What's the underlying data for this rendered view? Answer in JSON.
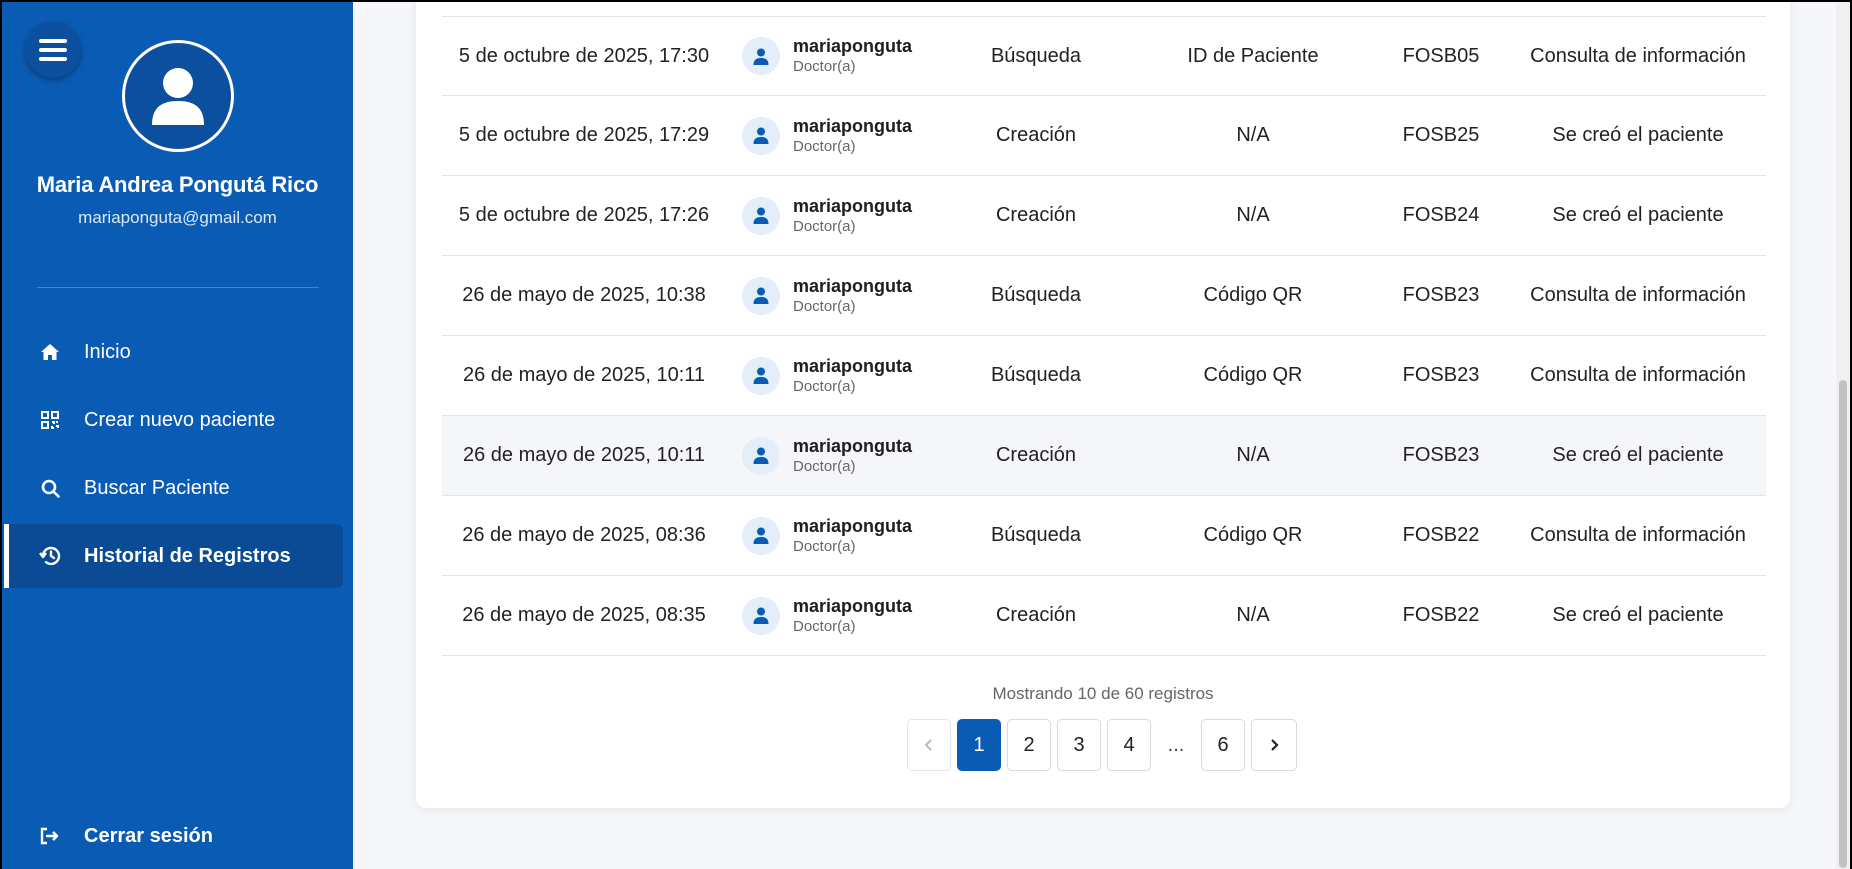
{
  "sidebar": {
    "user_name": "Maria Andrea Pongutá Rico",
    "user_email": "mariaponguta@gmail.com",
    "items": [
      {
        "label": "Inicio",
        "icon": "home-icon"
      },
      {
        "label": "Crear nuevo paciente",
        "icon": "qr-code-icon"
      },
      {
        "label": "Buscar Paciente",
        "icon": "search-icon"
      },
      {
        "label": "Historial de Registros",
        "icon": "history-icon",
        "active": true
      }
    ],
    "logout_label": "Cerrar sesión"
  },
  "table": {
    "rows": [
      {
        "date": "5 de octubre de 2025, 17:30",
        "user": "mariaponguta",
        "role": "Doctor(a)",
        "type": "Búsqueda",
        "method": "ID de Paciente",
        "id": "FOSB05",
        "desc": "Consulta de información"
      },
      {
        "date": "5 de octubre de 2025, 17:29",
        "user": "mariaponguta",
        "role": "Doctor(a)",
        "type": "Creación",
        "method": "N/A",
        "id": "FOSB25",
        "desc": "Se creó el paciente"
      },
      {
        "date": "5 de octubre de 2025, 17:26",
        "user": "mariaponguta",
        "role": "Doctor(a)",
        "type": "Creación",
        "method": "N/A",
        "id": "FOSB24",
        "desc": "Se creó el paciente"
      },
      {
        "date": "26 de mayo de 2025, 10:38",
        "user": "mariaponguta",
        "role": "Doctor(a)",
        "type": "Búsqueda",
        "method": "Código QR",
        "id": "FOSB23",
        "desc": "Consulta de información"
      },
      {
        "date": "26 de mayo de 2025, 10:11",
        "user": "mariaponguta",
        "role": "Doctor(a)",
        "type": "Búsqueda",
        "method": "Código QR",
        "id": "FOSB23",
        "desc": "Consulta de información"
      },
      {
        "date": "26 de mayo de 2025, 10:11",
        "user": "mariaponguta",
        "role": "Doctor(a)",
        "type": "Creación",
        "method": "N/A",
        "id": "FOSB23",
        "desc": "Se creó el paciente"
      },
      {
        "date": "26 de mayo de 2025, 08:36",
        "user": "mariaponguta",
        "role": "Doctor(a)",
        "type": "Búsqueda",
        "method": "Código QR",
        "id": "FOSB22",
        "desc": "Consulta de información"
      },
      {
        "date": "26 de mayo de 2025, 08:35",
        "user": "mariaponguta",
        "role": "Doctor(a)",
        "type": "Creación",
        "method": "N/A",
        "id": "FOSB22",
        "desc": "Se creó el paciente"
      }
    ]
  },
  "pagination": {
    "summary": "Mostrando 10 de 60 registros",
    "prev": "‹",
    "pages": [
      "1",
      "2",
      "3",
      "4"
    ],
    "ellipsis": "...",
    "last": "6",
    "next": "›",
    "current": "1"
  },
  "colors": {
    "sidebar_bg": "#0a5bb4",
    "active_item_bg": "#0b4a94",
    "accent": "#0a5bb4"
  }
}
